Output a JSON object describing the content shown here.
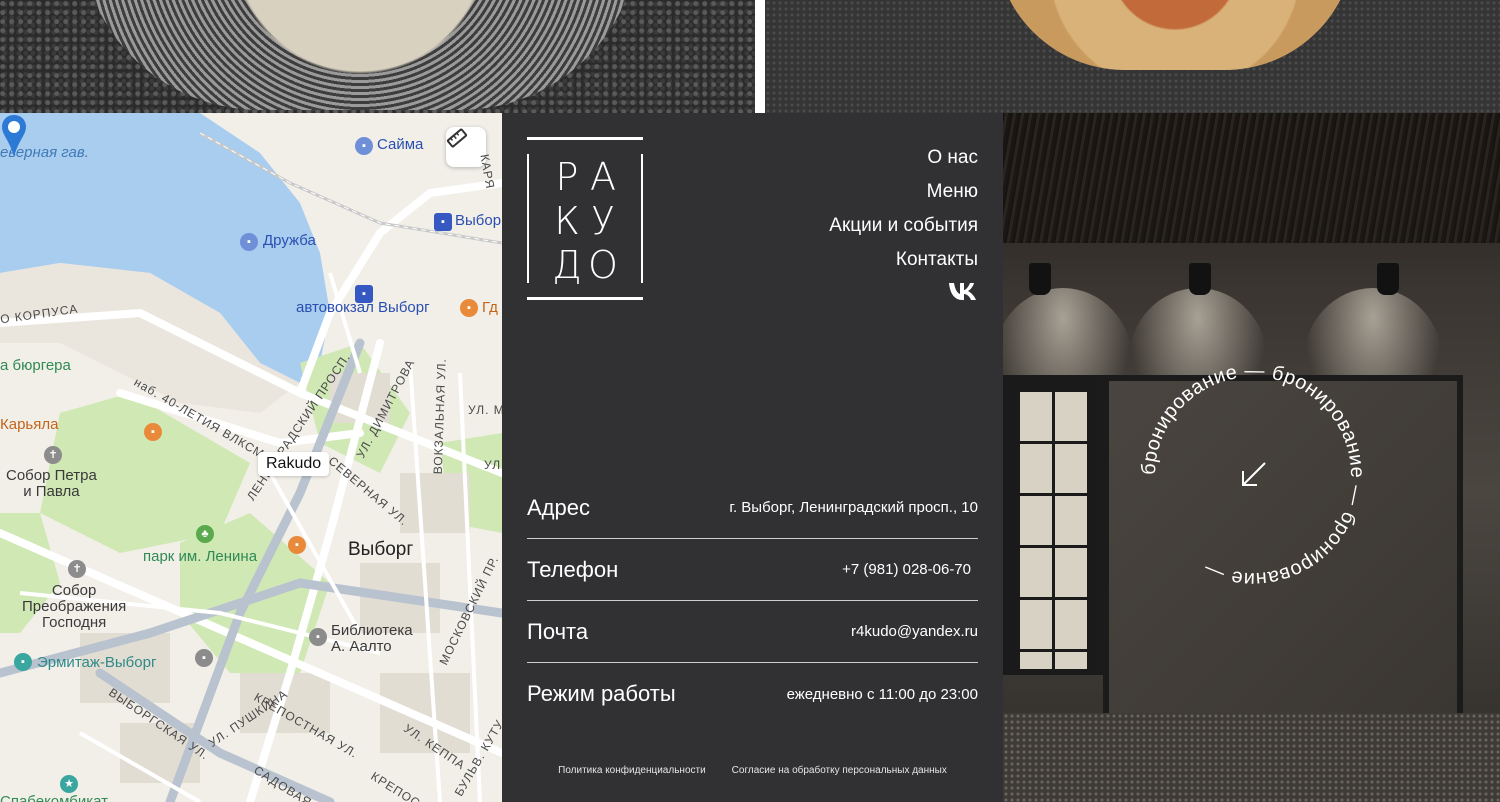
{
  "map": {
    "labels": {
      "harbor": "еверная гав.",
      "saima": "Сайма",
      "druzhba": "Дружба",
      "vyborg_station": "Выборг",
      "bus_station": "автовокзал Выборг",
      "gd": "Гд",
      "korpusa": "О КОРПУСА",
      "burger": "а бюргера",
      "karyala": "Карьяла",
      "cathedral_peter_paul": "Собор Петра\nи Павла",
      "park_lenin": "парк им. Ленина",
      "city": "Выборг",
      "cathedral_transfiguration": "Собор\nПреображения\nГосподня",
      "library": "Библиотека\nА. Аалто",
      "hermitage": "Эрмитаж-Выборг",
      "street_40let": "наб. 40-ЛЕТИЯ ВЛКСМ",
      "street_leningradsky": "ЛЕНИНГРАДСКИЙ ПРОСП.",
      "street_severnaya": "СЕВЕРНАЯ УЛ.",
      "street_dimitrova": "УЛ. ДИМИТРОВА",
      "street_vokzalnaya": "ВОКЗАЛЬНАЯ УЛ.",
      "street_moskovsky": "МОСКОВСКИЙ ПР.",
      "street_krepostnaya": "КРЕПОСТНАЯ УЛ.",
      "street_vyborgskaya": "ВЫБОРГСКАЯ УЛ.",
      "street_pushkina": "УЛ. ПУШКИНА",
      "street_sadovaya": "САДОВАЯ УЛ.",
      "street_keppa": "УЛ. КЕППА",
      "street_ul_m": "УЛ. М",
      "street_ul": "УЛ.",
      "street_krepos2": "КРЕПОС",
      "street_kutu": "БУЛЬВ. КУТУ",
      "street_karya": "КАРЯ",
      "bottom_poi": "Спабекомбикат"
    },
    "marker_label": "Rakudo"
  },
  "logo": {
    "letters": [
      "Р",
      "А",
      "К",
      "У",
      "Д",
      "О"
    ]
  },
  "nav": [
    "О нас",
    "Меню",
    "Акции и события",
    "Контакты"
  ],
  "contacts": [
    {
      "key": "Адрес",
      "value": "г. Выборг, Ленинградский просп., 10"
    },
    {
      "key": "Телефон",
      "value": "+7 (981) 028-06-70"
    },
    {
      "key": "Почта",
      "value": "r4kudo@yandex.ru"
    },
    {
      "key": "Режим работы",
      "value": "ежедневно с 11:00 до 23:00"
    }
  ],
  "legal": {
    "privacy": "Политика конфиденциальности",
    "consent": "Согласие на обработку персональных данных"
  },
  "booking": {
    "ring_text": "бронирование — бронирование — бронирование — "
  },
  "colors": {
    "panel": "#313134",
    "map_water": "#a9cdee",
    "map_park": "#cfe8b4",
    "pin": "#2d79d6"
  }
}
